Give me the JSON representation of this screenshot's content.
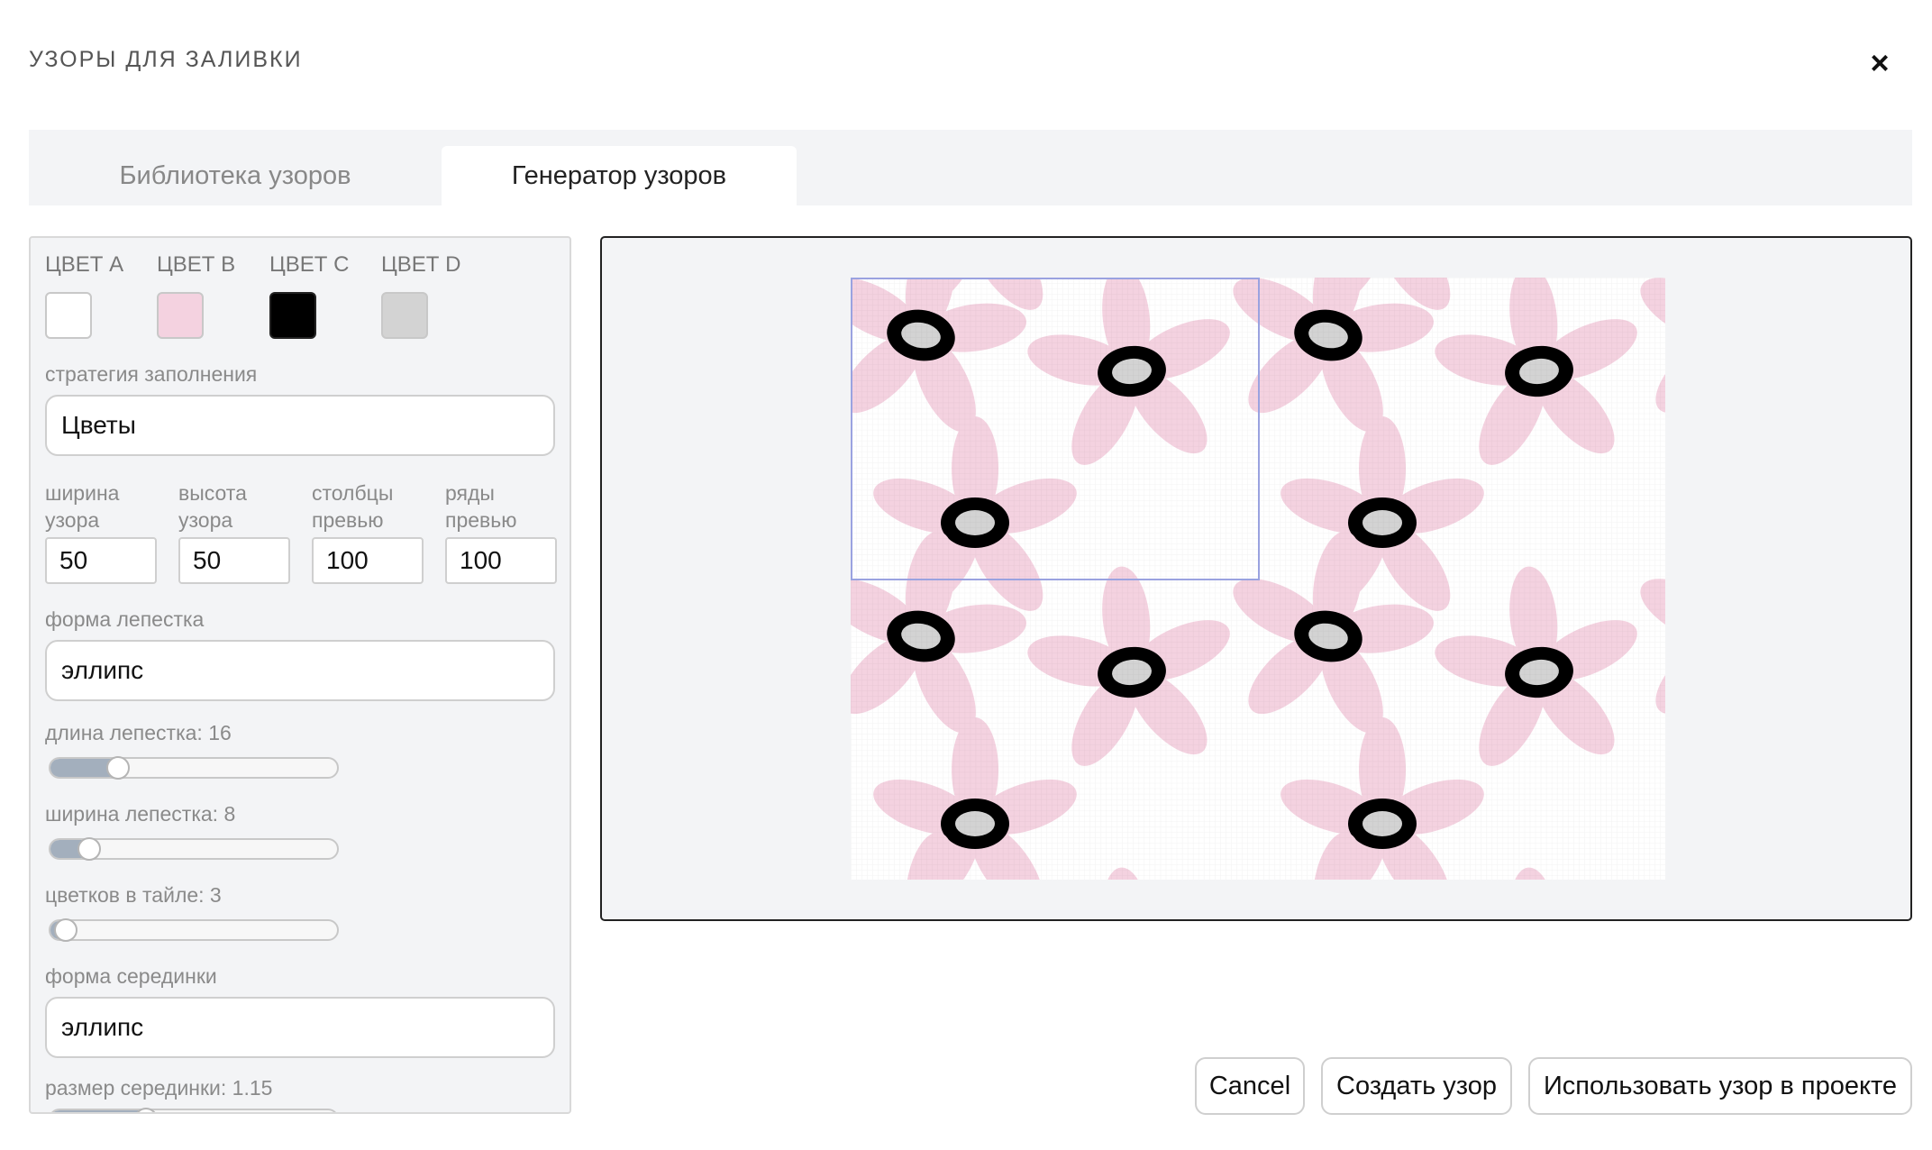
{
  "dialog": {
    "title": "УЗОРЫ ДЛЯ ЗАЛИВКИ",
    "close_icon": "×"
  },
  "tabs": [
    {
      "label": "Библиотека узоров",
      "active": false
    },
    {
      "label": "Генератор узоров",
      "active": true
    }
  ],
  "colors": [
    {
      "label": "ЦВЕТ A",
      "value": "#ffffff"
    },
    {
      "label": "ЦВЕТ B",
      "value": "#f4d2e0"
    },
    {
      "label": "ЦВЕТ C",
      "value": "#000000"
    },
    {
      "label": "ЦВЕТ D",
      "value": "#d3d3d3"
    }
  ],
  "strategy": {
    "label": "стратегия заполнения",
    "value": "Цветы"
  },
  "dimensions": [
    {
      "label_line1": "ширина",
      "label_line2": "узора",
      "value": "50"
    },
    {
      "label_line1": "высота",
      "label_line2": "узора",
      "value": "50"
    },
    {
      "label_line1": "столбцы",
      "label_line2": "превью",
      "value": "100"
    },
    {
      "label_line1": "ряды",
      "label_line2": "превью",
      "value": "100"
    }
  ],
  "petal_shape": {
    "label": "форма лепестка",
    "value": "эллипс"
  },
  "sliders": [
    {
      "label": "длина лепестка: 16",
      "fraction": 0.2
    },
    {
      "label": "ширина лепестка: 8",
      "fraction": 0.1
    },
    {
      "label": "цветков в тайле: 3",
      "fraction": 0.02
    },
    {
      "label": "размер серединки: 1.15",
      "fraction": 0.3
    }
  ],
  "center_shape": {
    "label": "форма серединки",
    "value": "эллипс"
  },
  "buttons": {
    "cancel": "Cancel",
    "create": "Создать узор",
    "use": "Использовать узор в проекте"
  }
}
